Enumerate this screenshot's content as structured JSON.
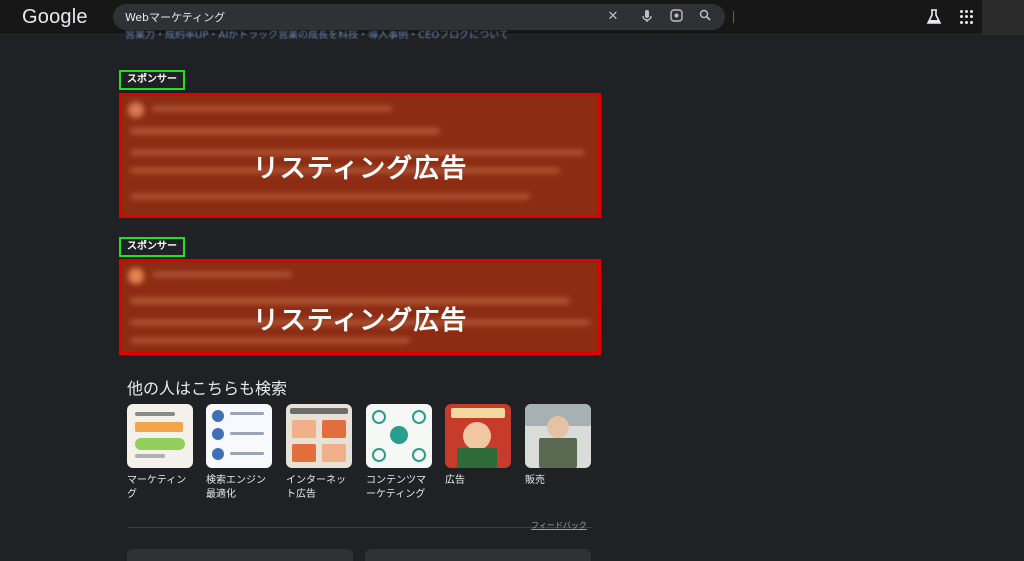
{
  "header": {
    "logo": "Google",
    "search_value": "Webマーケティング",
    "icons": [
      "close-icon",
      "mic-icon",
      "lens-icon",
      "search-icon",
      "labs-icon",
      "apps-grid-icon"
    ]
  },
  "partial_text": "営業力・成約率UP・AIがトラック営業の成長を科技・導入事例・CEOブログについて",
  "ads": [
    {
      "sponsor_label": "スポンサー",
      "overlay_label": "リスティング広告"
    },
    {
      "sponsor_label": "スポンサー",
      "overlay_label": "リスティング広告"
    }
  ],
  "others_search": {
    "title": "他の人はこちらも検索",
    "items": [
      {
        "label": "マーケティング"
      },
      {
        "label": "検索エンジン最適化"
      },
      {
        "label": "インターネット広告"
      },
      {
        "label": "コンテンツマーケティング"
      },
      {
        "label": "広告"
      },
      {
        "label": "販売"
      }
    ]
  },
  "feedback_label": "フィードバック",
  "colors": {
    "background": "#202124",
    "sponsor_border": "#22e022",
    "ad_border": "#e00000",
    "ad_fill": "#8c2c12",
    "link": "#8ab4f8"
  }
}
